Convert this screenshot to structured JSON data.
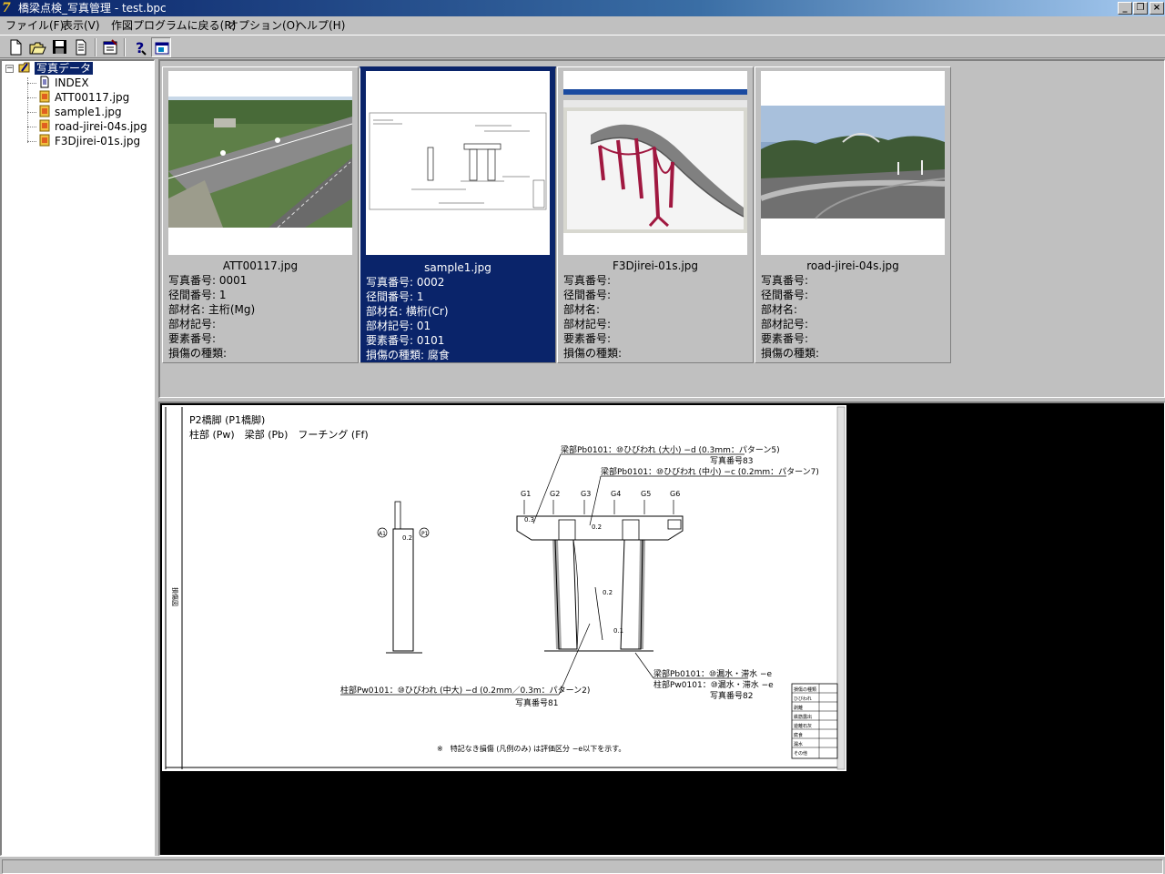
{
  "window": {
    "title": "橋梁点検_写真管理 - test.bpc"
  },
  "menu": {
    "items": [
      "ファイル(F)",
      "表示(V)",
      "作図プログラムに戻る(R)",
      "オプション(O)",
      "ヘルプ(H)"
    ]
  },
  "toolbar": {
    "buttons": [
      "new-icon",
      "open-icon",
      "save-icon",
      "document-icon",
      "properties-icon",
      "help-icon",
      "view-icon"
    ]
  },
  "tree": {
    "expander": "−",
    "root": "写真データ",
    "children": [
      "INDEX",
      "ATT00117.jpg",
      "sample1.jpg",
      "road-jirei-04s.jpg",
      "F3Djirei-01s.jpg"
    ]
  },
  "thumbnails": [
    {
      "filename": "ATT00117.jpg",
      "selected": false,
      "props": [
        "写真番号: 0001",
        "径間番号: 1",
        "部材名: 主桁(Mg)",
        "部材記号:",
        "要素番号:",
        "損傷の種類:"
      ]
    },
    {
      "filename": "sample1.jpg",
      "selected": true,
      "props": [
        "写真番号: 0002",
        "径間番号: 1",
        "部材名: 横桁(Cr)",
        "部材記号: 01",
        "要素番号: 0101",
        "損傷の種類: 腐食"
      ]
    },
    {
      "filename": "F3Djirei-01s.jpg",
      "selected": false,
      "props": [
        "写真番号:",
        "径間番号:",
        "部材名:",
        "部材記号:",
        "要素番号:",
        "損傷の種類:"
      ]
    },
    {
      "filename": "road-jirei-04s.jpg",
      "selected": false,
      "props": [
        "写真番号:",
        "径間番号:",
        "部材名:",
        "部材記号:",
        "要素番号:",
        "損傷の種類:"
      ]
    }
  ],
  "preview": {
    "heading1": "P2橋脚 (P1橋脚)",
    "heading2": "柱部 (Pw)　梁部 (Pb)　フーチング (Ff)",
    "callout1": "梁部Pb0101：⑩ひびわれ (大小) −d (0.3mm：パターン5)",
    "callout1_photo": "写真番号83",
    "callout2": "梁部Pb0101：⑩ひびわれ (中小) −c (0.2mm：パターン7)",
    "girders": [
      "G1",
      "G2",
      "G3",
      "G4",
      "G5",
      "G6"
    ],
    "callout3": "柱部Pw0101：⑩ひびわれ (中大) −d (0.2mm／0.3m：パターン2)",
    "callout3_photo": "写真番号81",
    "callout4a": "梁部Pb0101：⑩漏水・滞水 −e",
    "callout4b": "柱部Pw0101：⑩漏水・滞水 −e",
    "callout4_photo": "写真番号82",
    "side_label": "損傷図",
    "footnote": "※　特記なき損傷 (凡例のみ) は評価区分 −e以下を示す。",
    "measure_03": "0.3",
    "measure_02": "0.2",
    "measure_01": "0.1",
    "pier_labels": [
      "A1",
      "P1"
    ],
    "legend": [
      "損傷の種類",
      "ひびわれ",
      "剥離",
      "鉄筋露出",
      "遊離石灰",
      "腐食",
      "漏水",
      "その他"
    ]
  }
}
